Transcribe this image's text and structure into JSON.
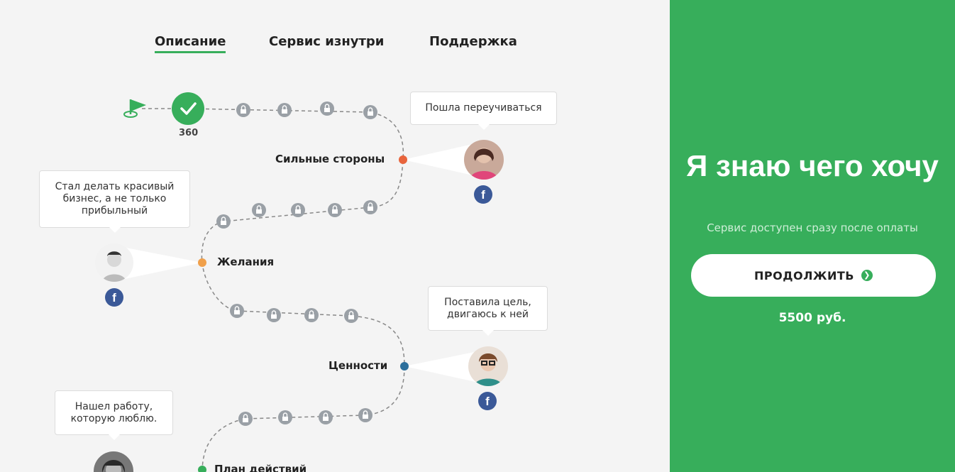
{
  "tabs": [
    {
      "label": "Описание",
      "active": true
    },
    {
      "label": "Сервис изнутри",
      "active": false
    },
    {
      "label": "Поддержка",
      "active": false
    }
  ],
  "progress": {
    "score": "360"
  },
  "stages": [
    {
      "label": "Сильные стороны",
      "color": "#e8643c"
    },
    {
      "label": "Желания",
      "color": "#f0a04b"
    },
    {
      "label": "Ценности",
      "color": "#2c6f9c"
    },
    {
      "label": "План действий",
      "color": "#37ae5b"
    }
  ],
  "testimonials": [
    {
      "quote": "Пошла переучиваться",
      "icon": "facebook-icon"
    },
    {
      "quote": "Стал делать красивый бизнес, а не только прибыльный",
      "icon": "facebook-icon"
    },
    {
      "quote": "Поставила цель, двигаюсь к ней",
      "icon": "facebook-icon"
    },
    {
      "quote": "Нашел работу, которую люблю.",
      "icon": "facebook-icon"
    }
  ],
  "offer": {
    "headline": "Я знаю чего хочу",
    "subtitle": "Сервис доступен сразу после оплаты",
    "button_label": "ПРОДОЛЖИТЬ",
    "price": "5500 руб."
  },
  "colors": {
    "accent": "#37ae5b",
    "lock": "#9aa0a6",
    "facebook": "#3b5998"
  }
}
